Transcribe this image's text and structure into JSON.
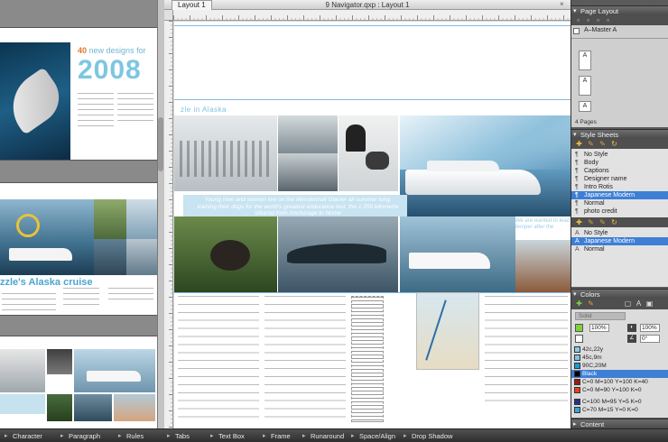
{
  "window": {
    "title": "9 Navigator.qxp : Layout 1",
    "tab_label": "Layout 1",
    "close_glyph": "×"
  },
  "navigator": {
    "spread1_heading_number": "40",
    "spread1_heading_text": "new designs for",
    "spread1_year": "2008",
    "spread2_title": "zzle's Alaska cruise"
  },
  "layout": {
    "section_head": "zle in Alaska",
    "caption_main": "Young men and women live on the Mendenhall Glacier all summer long, training their dogs for the world's greatest endurance test, the 1,050 kilometre Iditarod from Anchorage to Nome",
    "caption_right": "We are wanted to lead temper after the"
  },
  "palettes": {
    "page_layout": {
      "title": "Page Layout",
      "master_label": "A–Master A",
      "pages_count": "4 Pages",
      "page_thumbs": [
        "A",
        "A",
        "A"
      ]
    },
    "style_sheets": {
      "title": "Style Sheets",
      "paragraph_styles": [
        {
          "name": "No Style",
          "selected": false
        },
        {
          "name": "Body",
          "selected": false
        },
        {
          "name": "Captions",
          "selected": false
        },
        {
          "name": "Designer name",
          "selected": false
        },
        {
          "name": "Intro Rotis",
          "selected": false
        },
        {
          "name": "Japanese Modern",
          "selected": true
        },
        {
          "name": "Normal",
          "selected": false
        },
        {
          "name": "photo credit",
          "selected": false
        }
      ],
      "character_styles": [
        {
          "name": "No Style",
          "selected": false
        },
        {
          "name": "Japanese Modern",
          "selected": true
        },
        {
          "name": "Normal",
          "selected": false
        }
      ]
    },
    "colors": {
      "title": "Colors",
      "solid_label": "Solid",
      "shade_value_1": "100%",
      "shade_value_2": "100%",
      "angle_value": "0°",
      "items": [
        {
          "name": "42c,22y",
          "swatch": "#8ecbe0",
          "selected": false
        },
        {
          "name": "45c,9m",
          "swatch": "#7fc4e6",
          "selected": false
        },
        {
          "name": "90C,20M",
          "swatch": "#1a9ad4",
          "selected": false
        },
        {
          "name": "Black",
          "swatch": "#000000",
          "selected": true
        },
        {
          "name": "C=0 M=100 Y=100 K=40",
          "swatch": "#9a1a1a",
          "selected": false
        },
        {
          "name": "C=0 M=90 Y=100 K=0",
          "swatch": "#e8401a",
          "selected": false
        },
        {
          "name": "C=100 M=95 Y=5 K=0",
          "swatch": "#2a2e8c",
          "selected": false
        },
        {
          "name": "C=70 M=15 Y=0 K=0",
          "swatch": "#3aa6dc",
          "selected": false
        }
      ]
    },
    "content": {
      "title": "Content"
    }
  },
  "bottom_bar": {
    "items": [
      "Character",
      "Paragraph",
      "Rules",
      "Tabs",
      "Text Box",
      "Frame",
      "Runaround",
      "Space/Align",
      "Drop Shadow"
    ]
  }
}
